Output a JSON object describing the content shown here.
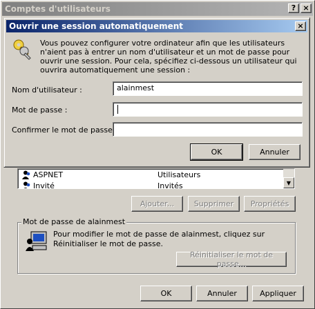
{
  "main_window": {
    "title": "Comptes d'utilisateurs",
    "help_button": "?",
    "close_button": "×"
  },
  "users_list": {
    "rows": [
      {
        "name": "ASPNET",
        "group": "Utilisateurs"
      },
      {
        "name": "Invité",
        "group": "Invités"
      }
    ]
  },
  "list_actions": {
    "add_label": "Ajouter...",
    "remove_label": "Supprimer",
    "properties_label": "Propriétés"
  },
  "password_group": {
    "title": "Mot de passe de alainmest",
    "description": "Pour modifier le mot de passe de alainmest, cliquez sur Réinitialiser le mot de passe.",
    "reset_label": "Réinitialiser le mot de passe..."
  },
  "footer": {
    "ok_label": "OK",
    "cancel_label": "Annuler",
    "apply_label": "Appliquer"
  },
  "autologon_dialog": {
    "title": "Ouvrir une session automatiquement",
    "close_button": "×",
    "description": "Vous pouvez configurer votre ordinateur afin que les utilisateurs n'aient pas à entrer un nom d'utilisateur et un mot de passe pour ouvrir une session. Pour cela, spécifiez ci-dessous un utilisateur qui ouvrira automatiquement une session :",
    "username_label": "Nom d'utilisateur :",
    "username_value": "alainmest",
    "password_label": "Mot de passe :",
    "password_value": "",
    "confirm_label": "Confirmer le mot de passe :",
    "confirm_value": "",
    "ok_label": "OK",
    "cancel_label": "Annuler"
  }
}
